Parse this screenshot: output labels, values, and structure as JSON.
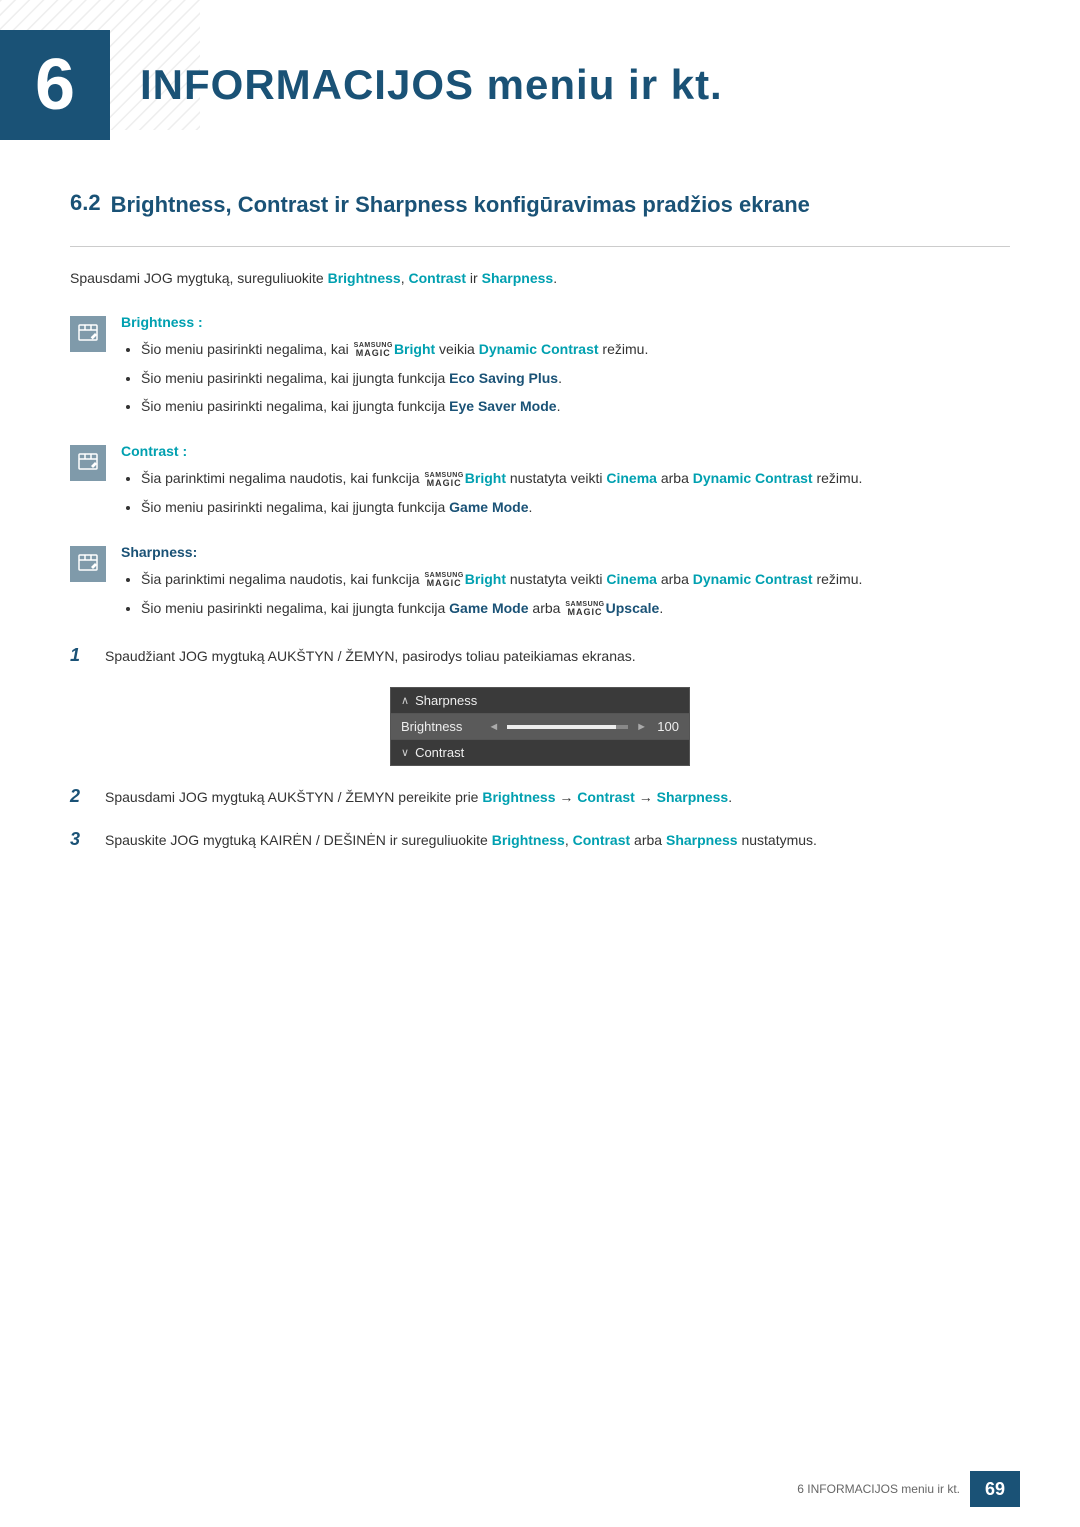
{
  "chapter": {
    "number": "6",
    "title": "INFORMACIJOS meniu ir kt.",
    "number_box_color": "#1a5276"
  },
  "section": {
    "number": "6.2",
    "title": "Brightness, Contrast ir Sharpness konfigūravimas pradžios ekrane"
  },
  "intro": {
    "text": "Spausdami JOG mygtuką, sureguliuokite ",
    "bold1": "Brightness",
    "sep1": ", ",
    "bold2": "Contrast",
    "sep2": " ir ",
    "bold3": "Sharpness",
    "end": "."
  },
  "note_brightness": {
    "label": "Brightness",
    "colon": " :",
    "bullets": [
      {
        "pre": "Šio meniu pasirinkti negalima, kai ",
        "samsung": "SAMSUNG MAGIC",
        "bold": "Bright",
        "post": " veikia ",
        "bold2": "Dynamic Contrast",
        "post2": " režimu."
      },
      {
        "pre": "Šio meniu pasirinkti negalima, kai įjungta funkcija ",
        "bold": "Eco Saving Plus",
        "post": "."
      },
      {
        "pre": "Šio meniu pasirinkti negalima, kai įjungta funkcija ",
        "bold": "Eye Saver Mode",
        "post": "."
      }
    ]
  },
  "note_contrast": {
    "label": "Contrast",
    "colon": " :",
    "bullets": [
      {
        "pre": "Šia parinktimi negalima naudotis, kai funkcija ",
        "samsung": "SAMSUNG MAGIC",
        "bold": "Bright",
        "post": " nustatyta veikti ",
        "bold2": "Cinema",
        "post2": " arba ",
        "bold3": "Dynamic Contrast",
        "post3": " režimu."
      },
      {
        "pre": "Šio meniu pasirinkti negalima, kai įjungta funkcija ",
        "bold": "Game Mode",
        "post": "."
      }
    ]
  },
  "note_sharpness": {
    "label": "Sharpness",
    "colon": ":",
    "bullets": [
      {
        "pre": "Šia parinktimi negalima naudotis, kai funkcija ",
        "samsung": "SAMSUNG MAGIC",
        "bold": "Bright",
        "post": " nustatyta veikti ",
        "bold2": "Cinema",
        "post2": " arba ",
        "bold3": "Dynamic Contrast",
        "post3": " režimu."
      },
      {
        "pre": "Šio meniu pasirinkti negalima, kai įjungta funkcija ",
        "bold": "Game Mode",
        "post": " arba ",
        "samsung2": "SAMSUNG MAGIC",
        "bold2": "Upscale",
        "post2": "."
      }
    ]
  },
  "step1": {
    "number": "1",
    "text": "Spaudžiant JOG mygtuką AUKŠTYN / ŽEMYN, pasirodys toliau pateikiamas ekranas."
  },
  "ui_box": {
    "row_sharpness": {
      "arrow_up": "∧",
      "label": "Sharpness"
    },
    "row_brightness": {
      "label": "Brightness",
      "arrow_left": "◄",
      "arrow_right": "►",
      "value": "100"
    },
    "row_contrast": {
      "arrow_down": "∨",
      "label": "Contrast"
    }
  },
  "step2": {
    "number": "2",
    "pre": "Spausdami JOG mygtuką AUKŠTYN / ŽEMYN pereikite prie ",
    "bold1": "Brightness",
    "sep1": " → ",
    "bold2": "Contrast",
    "sep2": " → ",
    "bold3": "Sharpness",
    "post": "."
  },
  "step3": {
    "number": "3",
    "pre": "Spauskite JOG mygtuką KAIRĖN / DEŠINĖN ir sureguliuokite ",
    "bold1": "Brightness",
    "sep1": ", ",
    "bold2": "Contrast",
    "post1": " arba ",
    "bold3": "Sharpness",
    "post2": " nustatymus."
  },
  "footer": {
    "text": "6 INFORMACIJOS meniu ir kt.",
    "page_number": "69"
  }
}
